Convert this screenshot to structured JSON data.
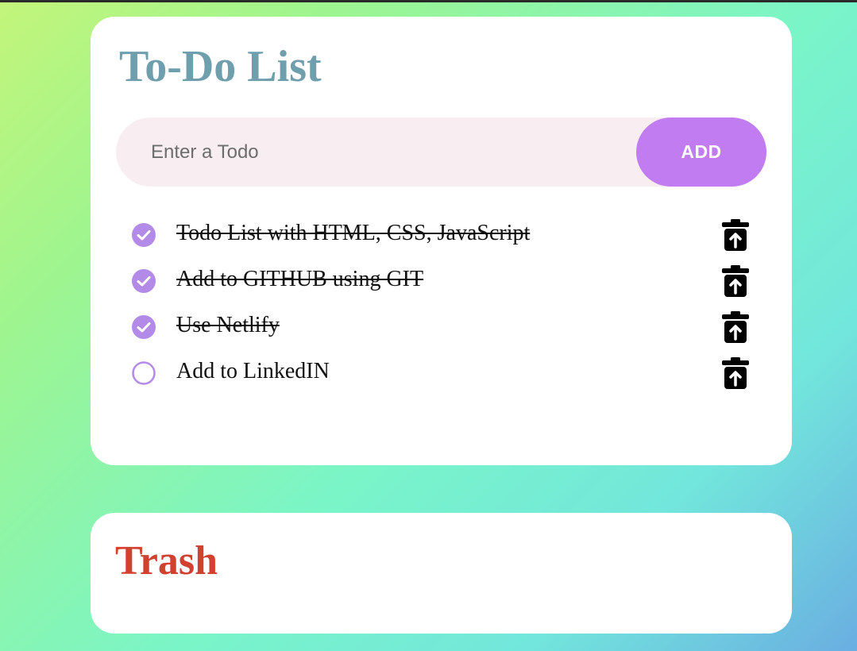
{
  "todo": {
    "title": "To-Do List",
    "input_placeholder": "Enter a Todo",
    "input_value": "",
    "add_label": "ADD",
    "items": [
      {
        "text": "Todo List with HTML, CSS, JavaScript",
        "completed": true
      },
      {
        "text": "Add to GITHUB using GIT",
        "completed": true
      },
      {
        "text": "Use Netlify",
        "completed": true
      },
      {
        "text": "Add to LinkedIN",
        "completed": false
      }
    ]
  },
  "trash": {
    "title": "Trash"
  },
  "icons": {
    "checked": "check-circle-icon",
    "unchecked": "empty-circle-icon",
    "restore": "trash-restore-icon"
  },
  "colors": {
    "title": "#6f9ead",
    "trash_title": "#d2412f",
    "accent": "#c07cf0",
    "check": "#b38ae8",
    "input_bg": "#f8eef1"
  }
}
